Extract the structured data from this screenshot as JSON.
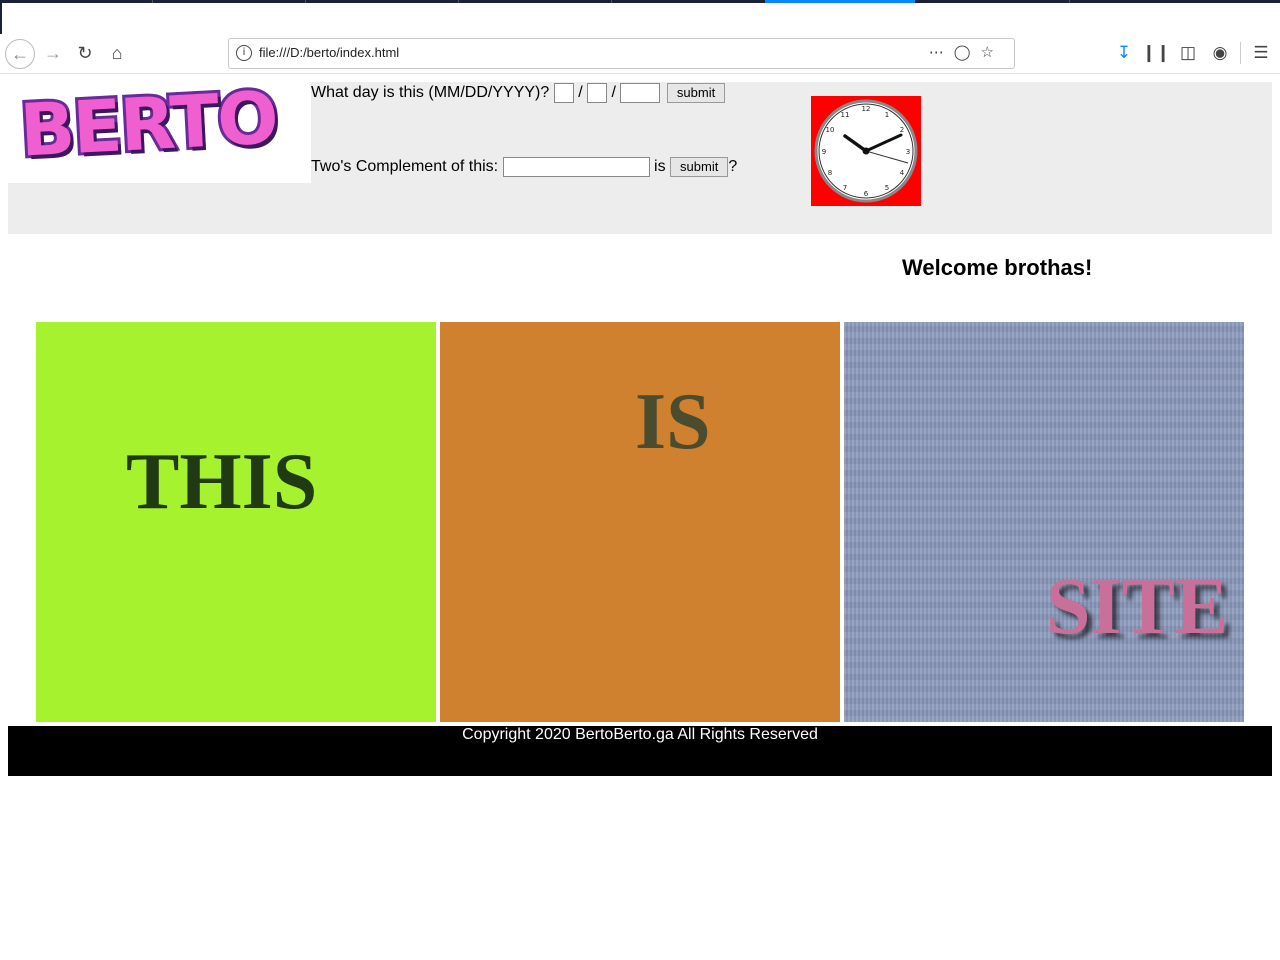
{
  "browser": {
    "url": "file:///D:/berto/index.html"
  },
  "header": {
    "date_prompt": "What day is this (MM/DD/YYYY)?",
    "date_sep": "/",
    "date_submit": "submit",
    "twos_prompt": "Two's Complement of this:",
    "twos_is": "is",
    "twos_submit": "submit",
    "twos_end": "?",
    "logo_text": "BERTO"
  },
  "welcome": "Welcome brothas!",
  "panels": {
    "this": "THIS",
    "is": "IS",
    "site": "SITE"
  },
  "footer": "Copyright 2020 BertoBerto.ga All Rights Reserved",
  "colors": {
    "panel_this": "#a6f22f",
    "panel_is": "#cf812f",
    "panel_site": "#8a98bb",
    "clock_bg": "#ff0000"
  }
}
